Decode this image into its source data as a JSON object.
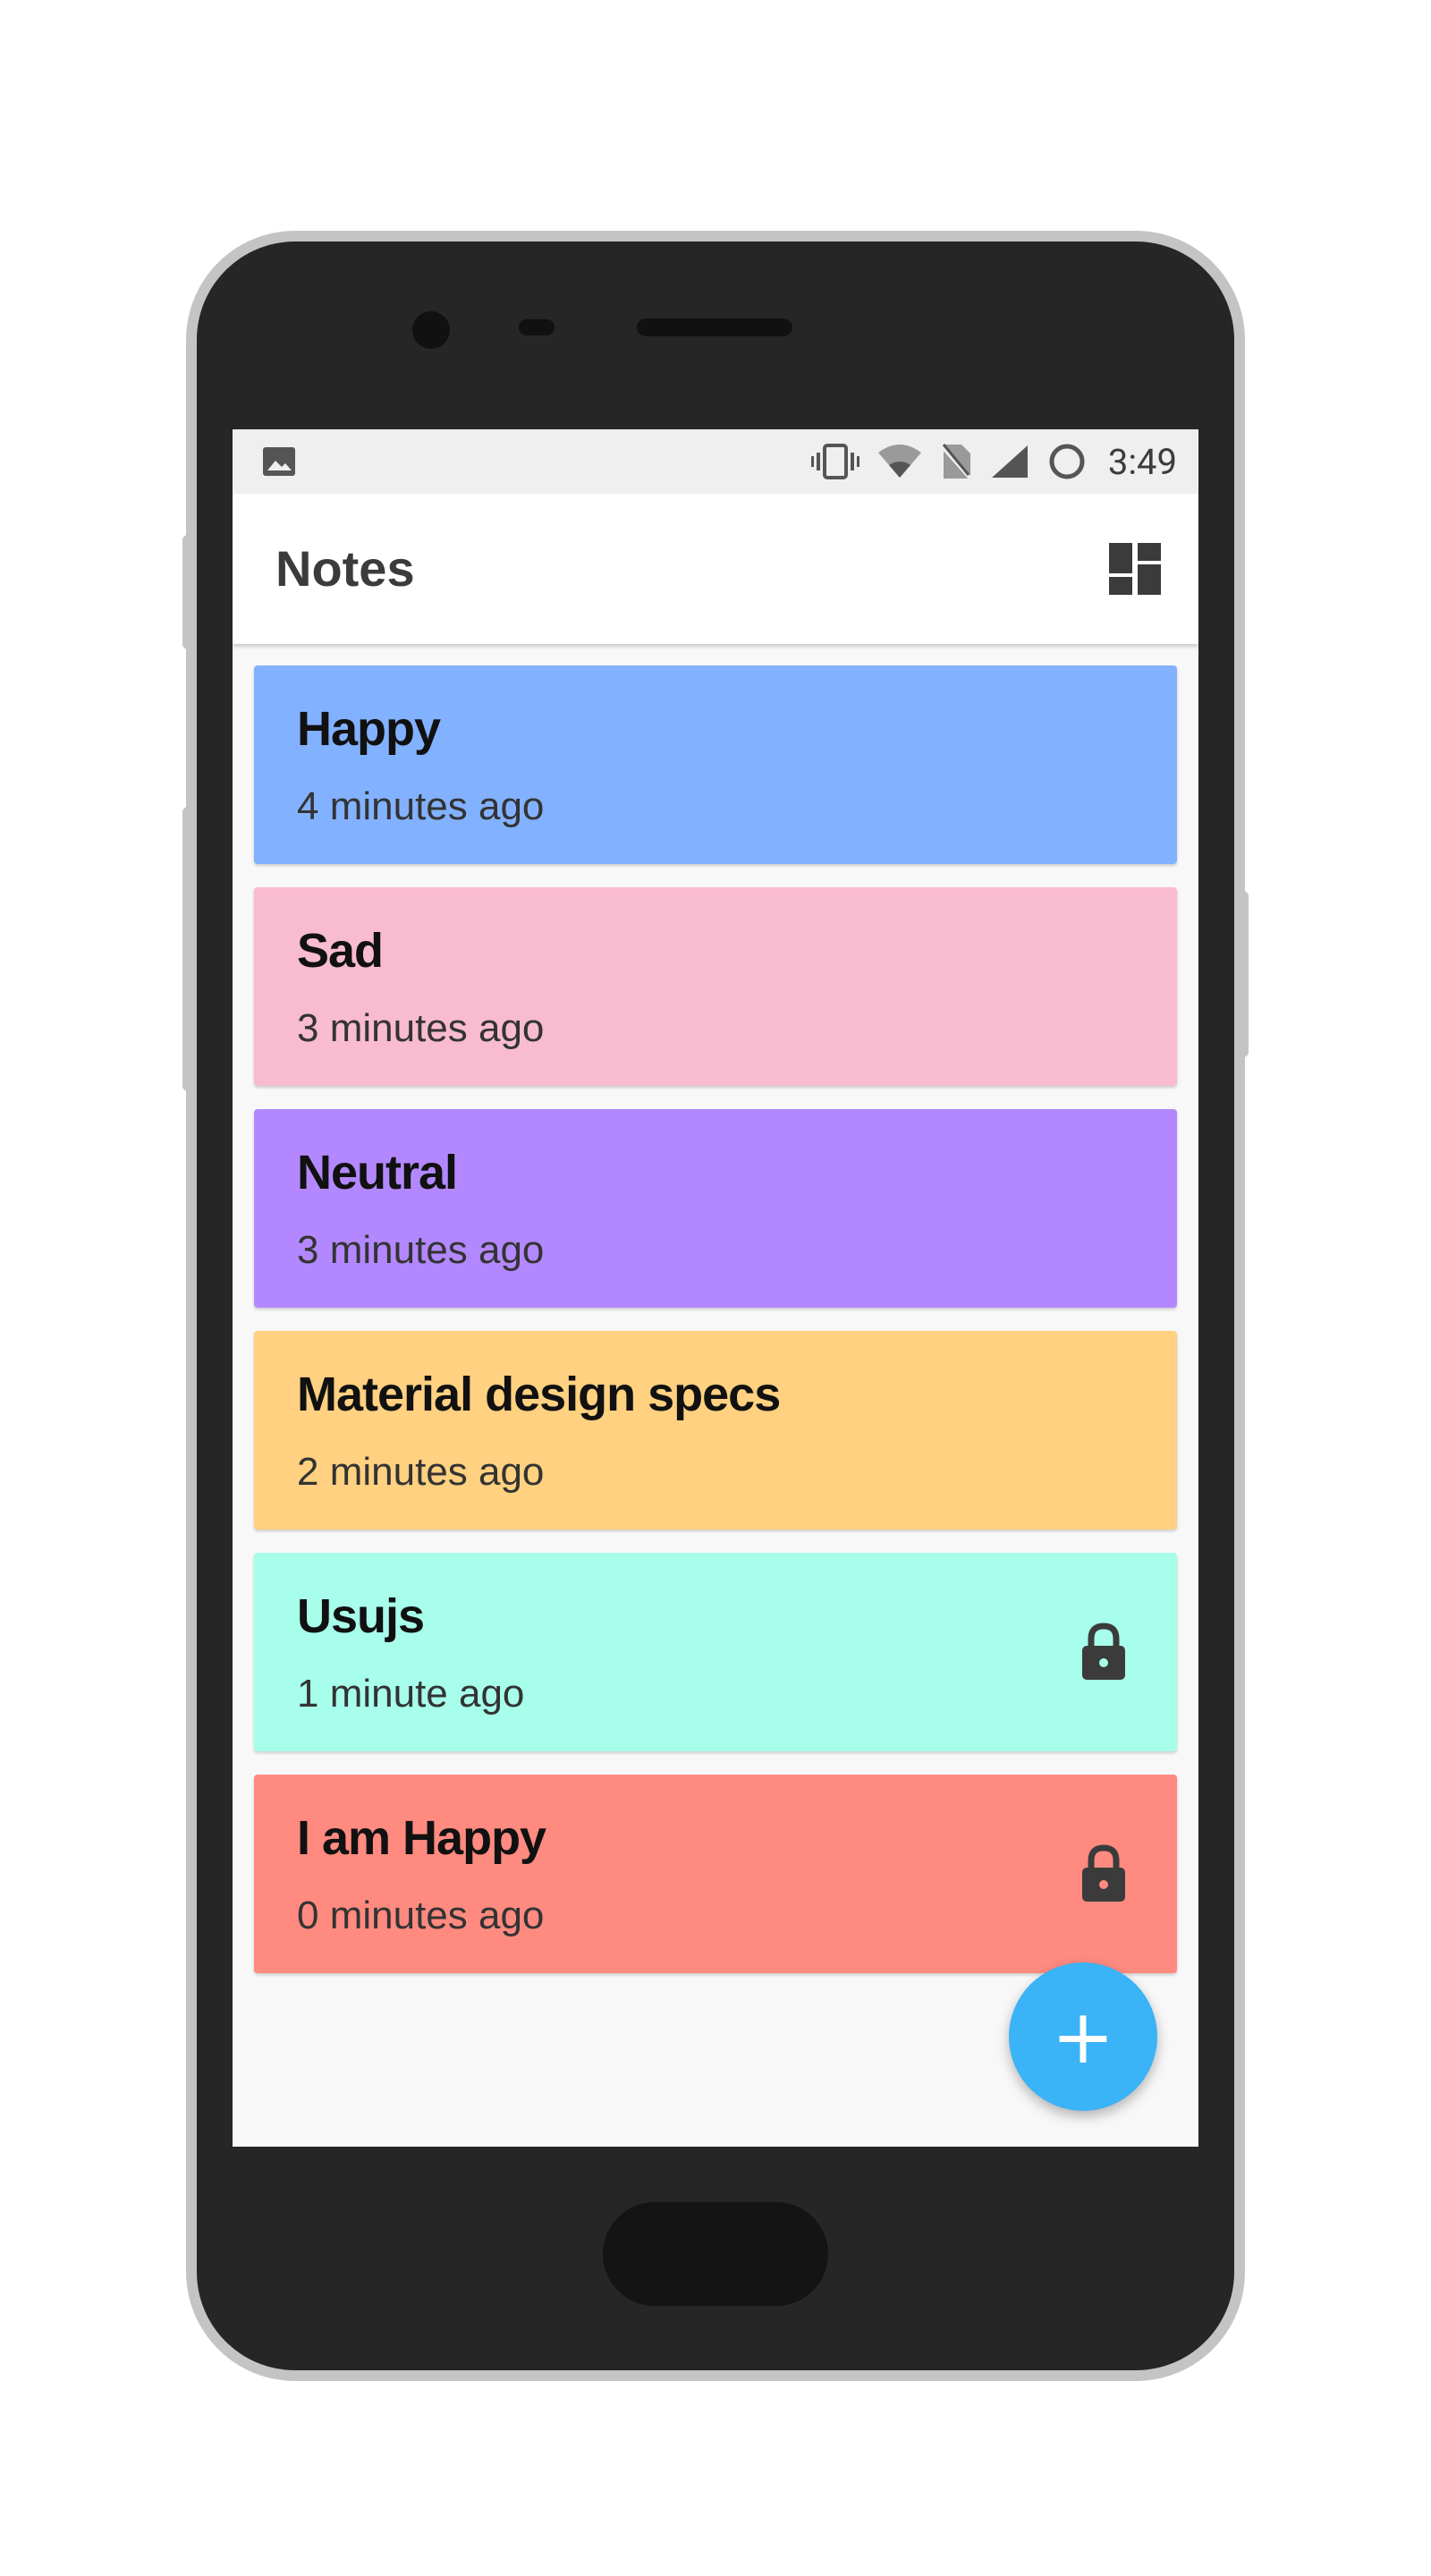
{
  "status_bar": {
    "time": "3:49",
    "icons": [
      "image-icon",
      "vibrate-icon",
      "wifi-icon",
      "no-sim-icon",
      "signal-icon",
      "sync-icon"
    ]
  },
  "app_bar": {
    "title": "Notes",
    "layout_toggle_icon": "dashboard-layout-icon"
  },
  "notes": [
    {
      "title": "Happy",
      "time": "4 minutes ago",
      "color": "#82b1ff",
      "locked": false
    },
    {
      "title": "Sad",
      "time": "3 minutes ago",
      "color": "#f8bbd0",
      "locked": false
    },
    {
      "title": "Neutral",
      "time": "3 minutes ago",
      "color": "#b388ff",
      "locked": false
    },
    {
      "title": "Material design specs",
      "time": "2 minutes ago",
      "color": "#ffd180",
      "locked": false
    },
    {
      "title": "Usujs",
      "time": "1 minute ago",
      "color": "#a7ffeb",
      "locked": true
    },
    {
      "title": "I am Happy",
      "time": "0 minutes ago",
      "color": "#ff8a80",
      "locked": true
    }
  ],
  "fab": {
    "label": "+",
    "color": "#3ab3f7"
  }
}
